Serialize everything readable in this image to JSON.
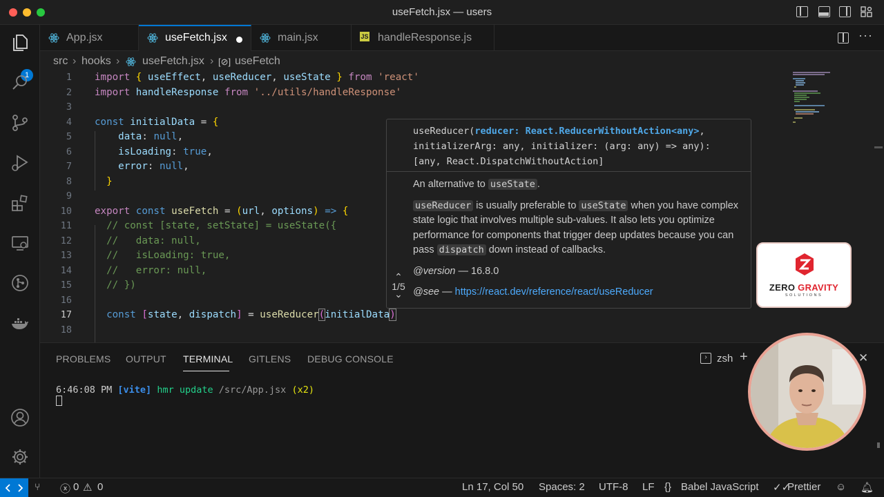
{
  "window": {
    "title": "useFetch.jsx — users"
  },
  "activity_bar": {
    "explorer_badge": "1"
  },
  "tabs": [
    {
      "label": "App.jsx",
      "icon": "react-icon"
    },
    {
      "label": "useFetch.jsx",
      "icon": "react-icon",
      "active": true,
      "dirty": true
    },
    {
      "label": "main.jsx",
      "icon": "react-icon"
    },
    {
      "label": "handleResponse.js",
      "icon": "js-icon"
    }
  ],
  "breadcrumbs": [
    "src",
    "hooks",
    "useFetch.jsx",
    "useFetch"
  ],
  "editor": {
    "line_numbers": [
      "1",
      "2",
      "3",
      "4",
      "5",
      "6",
      "7",
      "8",
      "9",
      "10",
      "11",
      "12",
      "13",
      "14",
      "15",
      "16",
      "17",
      "18"
    ],
    "current_line": "17"
  },
  "hover": {
    "sig_fn": "useReducer",
    "sig_param1": "reducer: React.ReducerWithoutAction<any>",
    "sig_line2": "initializerArg: any, initializer: (arg: any) => any):",
    "sig_line3": "[any, React.DispatchWithoutAction]",
    "doc1_pre": "An alternative to ",
    "doc1_code": "useState",
    "doc1_post": ".",
    "doc2_code1": "useReducer",
    "doc2_text1": " is usually preferable to ",
    "doc2_code2": "useState",
    "doc2_text2": " when you have complex state logic that involves multiple sub-values. It also lets you optimize performance for components that trigger deep updates because you can pass ",
    "doc2_code3": "dispatch",
    "doc2_text3": " down instead of callbacks.",
    "version_tag": "@version",
    "version_value": " — 16.8.0",
    "see_tag": "@see",
    "see_dash": " — ",
    "see_link": "https://react.dev/reference/react/useReducer",
    "nav_count": "1/5"
  },
  "panel": {
    "tabs": [
      "PROBLEMS",
      "OUTPUT",
      "TERMINAL",
      "GITLENS",
      "DEBUG CONSOLE"
    ],
    "active_tab": "TERMINAL",
    "shell": "zsh",
    "terminal": {
      "time": "6:46:08 PM",
      "tag": "[vite]",
      "msg": "hmr update",
      "path": "/src/App.jsx",
      "count": "(x2)"
    }
  },
  "status_bar": {
    "errors": "0",
    "warnings": "0",
    "position": "Ln 17, Col 50",
    "spaces": "Spaces: 2",
    "encoding": "UTF-8",
    "eol": "LF",
    "language": "Babel JavaScript",
    "formatter": "Prettier"
  },
  "logo": {
    "word1": "ZERO",
    "word2": "GRAVITY",
    "sub": "SOLUTIONS"
  },
  "colors": {
    "accent": "#0078d4",
    "statusbar_remote": "#0078d4",
    "link": "#4daafc"
  }
}
